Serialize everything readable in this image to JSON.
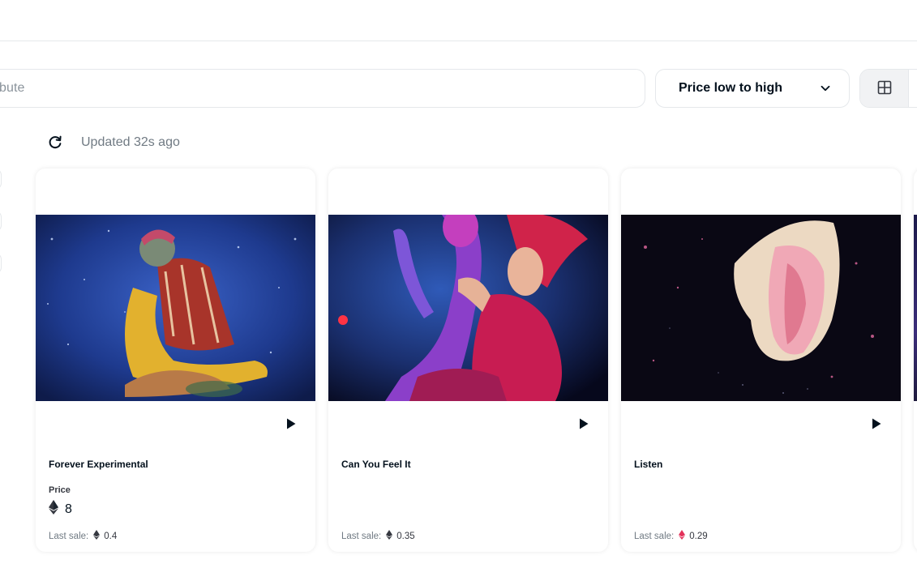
{
  "search": {
    "placeholder_visible": "bute"
  },
  "sort": {
    "selected": "Price low to high"
  },
  "status": {
    "updated": "Updated 32s ago"
  },
  "cards": [
    {
      "name": "Forever Experimental",
      "price_label": "Price",
      "price": "8",
      "last_sale_label": "Last sale:",
      "last_sale": "0.4",
      "eth_color": "#353840"
    },
    {
      "name": "Can You Feel It",
      "last_sale_label": "Last sale:",
      "last_sale": "0.35",
      "eth_color": "#353840"
    },
    {
      "name": "Listen",
      "last_sale_label": "Last sale:",
      "last_sale": "0.29",
      "eth_color": "#e3315a"
    }
  ],
  "icons": {
    "refresh": "refresh-icon",
    "chevron": "chevron-down-icon",
    "grid": "grid-view-icon",
    "play": "play-icon",
    "eth": "ethereum-icon"
  }
}
